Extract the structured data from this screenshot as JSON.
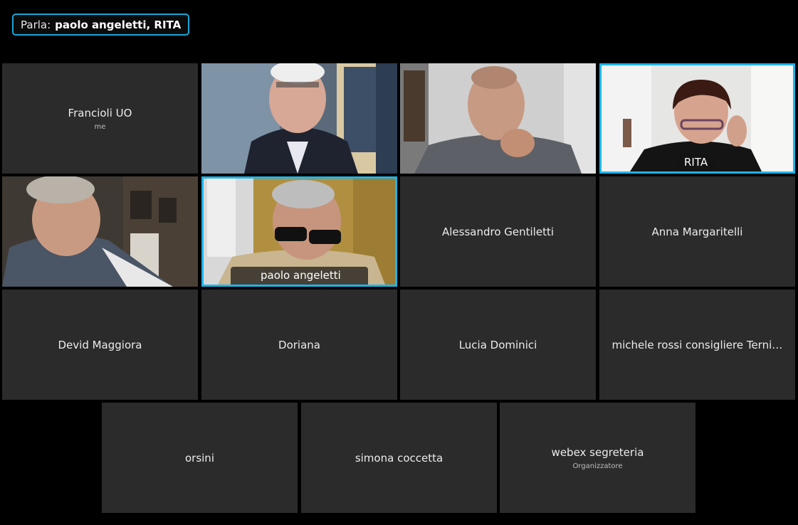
{
  "speaking": {
    "label": "Parla:",
    "names": "paolo angeletti, RITA"
  },
  "participants": [
    {
      "name": "Francioli UO",
      "subtitle": "me"
    },
    {
      "name": ""
    },
    {
      "name": ""
    },
    {
      "name": "RITA"
    },
    {
      "name": ""
    },
    {
      "name": "paolo angeletti"
    },
    {
      "name": "Alessandro Gentiletti"
    },
    {
      "name": "Anna Margaritelli"
    },
    {
      "name": "Devid Maggiora"
    },
    {
      "name": "Doriana"
    },
    {
      "name": "Lucia Dominici"
    },
    {
      "name": "michele rossi consigliere Terni Ci..."
    },
    {
      "name": "orsini"
    },
    {
      "name": "simona coccetta"
    },
    {
      "name": "webex segreteria",
      "subtitle": "Organizzatore"
    }
  ],
  "colors": {
    "active_border": "#1fb5ea",
    "tile_bg": "#2b2b2b",
    "speaking_border": "#1aa6d6"
  }
}
